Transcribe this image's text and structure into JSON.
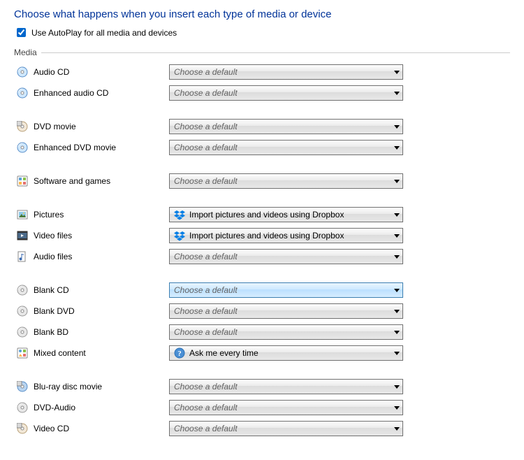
{
  "title": "Choose what happens when you insert each type of media or device",
  "autoplay_label": "Use AutoPlay for all media and devices",
  "autoplay_checked": true,
  "section_media": "Media",
  "defaults": {
    "choose": "Choose a default",
    "dropbox": "Import pictures and videos using Dropbox",
    "ask": "Ask me every time"
  },
  "groups": [
    {
      "rows": [
        {
          "icon": "disc-blue",
          "label": "Audio CD",
          "sel": "choose",
          "hl": false
        },
        {
          "icon": "disc-blue",
          "label": "Enhanced audio CD",
          "sel": "choose",
          "hl": false
        }
      ]
    },
    {
      "rows": [
        {
          "icon": "dvd-disc",
          "label": "DVD movie",
          "sel": "choose",
          "hl": false
        },
        {
          "icon": "disc-blue",
          "label": "Enhanced DVD movie",
          "sel": "choose",
          "hl": false
        }
      ]
    },
    {
      "rows": [
        {
          "icon": "software",
          "label": "Software and games",
          "sel": "choose",
          "hl": false
        }
      ]
    },
    {
      "rows": [
        {
          "icon": "pictures",
          "label": "Pictures",
          "sel": "dropbox",
          "hl": false
        },
        {
          "icon": "video",
          "label": "Video files",
          "sel": "dropbox",
          "hl": false
        },
        {
          "icon": "audio-file",
          "label": "Audio files",
          "sel": "choose",
          "hl": false
        }
      ]
    },
    {
      "rows": [
        {
          "icon": "disc-grey",
          "label": "Blank CD",
          "sel": "choose",
          "hl": true
        },
        {
          "icon": "disc-grey",
          "label": "Blank DVD",
          "sel": "choose",
          "hl": false
        },
        {
          "icon": "disc-grey",
          "label": "Blank BD",
          "sel": "choose",
          "hl": false
        },
        {
          "icon": "mixed",
          "label": "Mixed content",
          "sel": "ask",
          "hl": false
        }
      ]
    },
    {
      "rows": [
        {
          "icon": "bluray",
          "label": "Blu-ray disc movie",
          "sel": "choose",
          "hl": false
        },
        {
          "icon": "disc-grey",
          "label": "DVD-Audio",
          "sel": "choose",
          "hl": false
        },
        {
          "icon": "dvd-disc",
          "label": "Video CD",
          "sel": "choose",
          "hl": false
        }
      ]
    }
  ]
}
